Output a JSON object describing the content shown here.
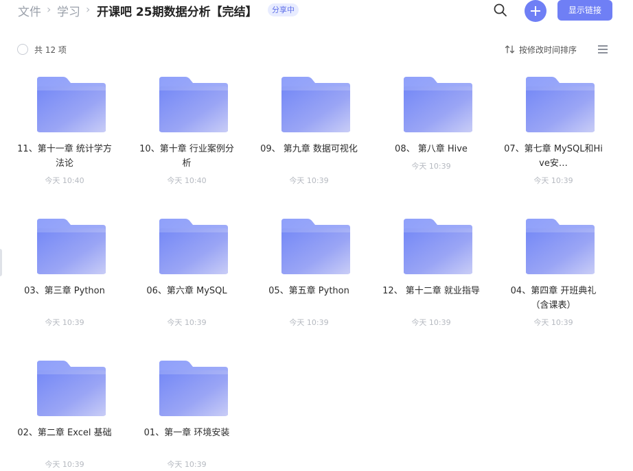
{
  "breadcrumb": {
    "root": "文件",
    "parent": "学习",
    "separator": "›"
  },
  "title": "开课吧 25期数据分析【完结】",
  "badge": "分享中",
  "actions": {
    "share_button": "显示链接"
  },
  "toolbar": {
    "count_label": "共 12 项",
    "sort_label": "按修改时间排序"
  },
  "colors": {
    "accent": "#6f7ff5",
    "folder_light": "#a5b3fc",
    "folder_dark": "#7b86f4"
  },
  "items": [
    {
      "name": "11、第十一章 统计学方法论",
      "time": "今天 10:40",
      "lines": 2
    },
    {
      "name": "10、第十章 行业案例分析",
      "time": "今天 10:40",
      "lines": 2
    },
    {
      "name": "09、 第九章 数据可视化",
      "time": "今天 10:39",
      "lines": 2
    },
    {
      "name": "08、 第八章 Hive",
      "time": "今天 10:39",
      "lines": 1
    },
    {
      "name": "07、第七章 MySQL和Hive安…",
      "time": "今天 10:39",
      "lines": 2
    },
    {
      "name": "03、第三章 Python",
      "time": "今天 10:39",
      "lines": 2
    },
    {
      "name": "06、第六章 MySQL",
      "time": "今天 10:39",
      "lines": 2
    },
    {
      "name": "05、第五章 Python",
      "time": "今天 10:39",
      "lines": 2
    },
    {
      "name": "12、 第十二章 就业指导",
      "time": "今天 10:39",
      "lines": 2
    },
    {
      "name": "04、第四章 开班典礼（含课表）",
      "time": "今天 10:39",
      "lines": 2
    },
    {
      "name": "02、第二章 Excel 基础",
      "time": "今天 10:39",
      "lines": 2
    },
    {
      "name": "01、第一章 环境安装",
      "time": "今天 10:39",
      "lines": 2
    }
  ]
}
